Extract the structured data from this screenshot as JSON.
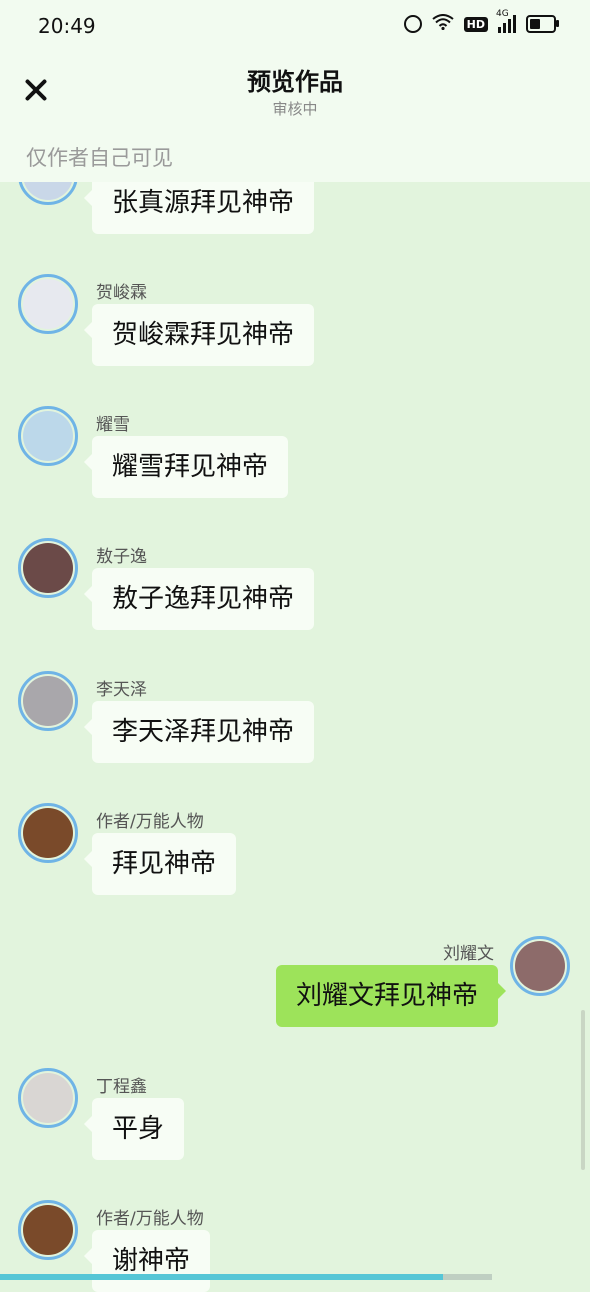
{
  "status": {
    "time": "20:49",
    "hd": "HD",
    "network": "4G",
    "battery_level": 0.38
  },
  "header": {
    "title": "预览作品",
    "subtitle": "审核中",
    "visibility": "仅作者自己可见"
  },
  "messages": [
    {
      "name": "",
      "text": "张真源拜见神帝",
      "side": "left",
      "avatar_color": "#c9d7e8"
    },
    {
      "name": "贺峻霖",
      "text": "贺峻霖拜见神帝",
      "side": "left",
      "avatar_color": "#e7e9ef"
    },
    {
      "name": "耀雪",
      "text": "耀雪拜见神帝",
      "side": "left",
      "avatar_color": "#bcd8ea"
    },
    {
      "name": "敖子逸",
      "text": "敖子逸拜见神帝",
      "side": "left",
      "avatar_color": "#6b4a48"
    },
    {
      "name": "李天泽",
      "text": "李天泽拜见神帝",
      "side": "left",
      "avatar_color": "#a9a7ab"
    },
    {
      "name": "作者/万能人物",
      "text": "拜见神帝",
      "side": "left",
      "avatar_color": "#7a4a2a"
    },
    {
      "name": "刘耀文",
      "text": "刘耀文拜见神帝",
      "side": "right",
      "avatar_color": "#8d6b6a"
    },
    {
      "name": "丁程鑫",
      "text": "平身",
      "side": "left",
      "avatar_color": "#d9d6d3"
    },
    {
      "name": "作者/万能人物",
      "text": "谢神帝",
      "side": "left",
      "avatar_color": "#7a4a2a"
    }
  ],
  "scroll_progress": 0.9,
  "colors": {
    "background": "#e2f4dd",
    "header": "#f2fbf0",
    "bubble_left": "#f7fdf5",
    "bubble_right": "#9de35a",
    "avatar_ring": "#6fb4e6"
  }
}
